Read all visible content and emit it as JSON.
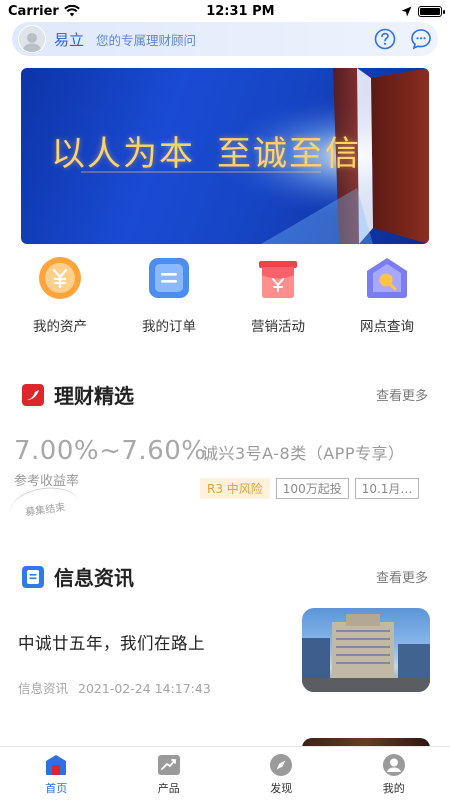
{
  "status_bar": {
    "carrier": "Carrier",
    "time": "12:31 PM"
  },
  "header": {
    "user_name": "易立",
    "subtitle": "您的专属理财顾问"
  },
  "banner": {
    "text_left": "以人为本",
    "text_right": "至诚至信"
  },
  "quick_menu": [
    {
      "label": "我的资产",
      "icon": "assets-icon"
    },
    {
      "label": "我的订单",
      "icon": "orders-icon"
    },
    {
      "label": "营销活动",
      "icon": "promotion-icon"
    },
    {
      "label": "网点查询",
      "icon": "branch-search-icon"
    }
  ],
  "finance_section": {
    "title": "理财精选",
    "more": "查看更多"
  },
  "product": {
    "rate": "7.00%~7.60%",
    "rate_label": "参考收益率",
    "stamp": "募集结束",
    "name": "诚兴3号A-8类（APP专享）",
    "tags": [
      "R3 中风险",
      "100万起投",
      "10.1月…"
    ]
  },
  "news_section": {
    "title": "信息资讯",
    "more": "查看更多"
  },
  "news": [
    {
      "title": "中诚廿五年，我们在路上",
      "category": "信息资讯",
      "date": "2021-02-24 14:17:43"
    }
  ],
  "tabs": [
    {
      "label": "首页",
      "icon": "home-icon",
      "active": true
    },
    {
      "label": "产品",
      "icon": "product-icon",
      "active": false
    },
    {
      "label": "发现",
      "icon": "compass-icon",
      "active": false
    },
    {
      "label": "我的",
      "icon": "profile-icon",
      "active": false
    }
  ],
  "colors": {
    "accent": "#2e6ee6",
    "banner": "#1a4bd3",
    "brand_red": "#e0262d"
  }
}
